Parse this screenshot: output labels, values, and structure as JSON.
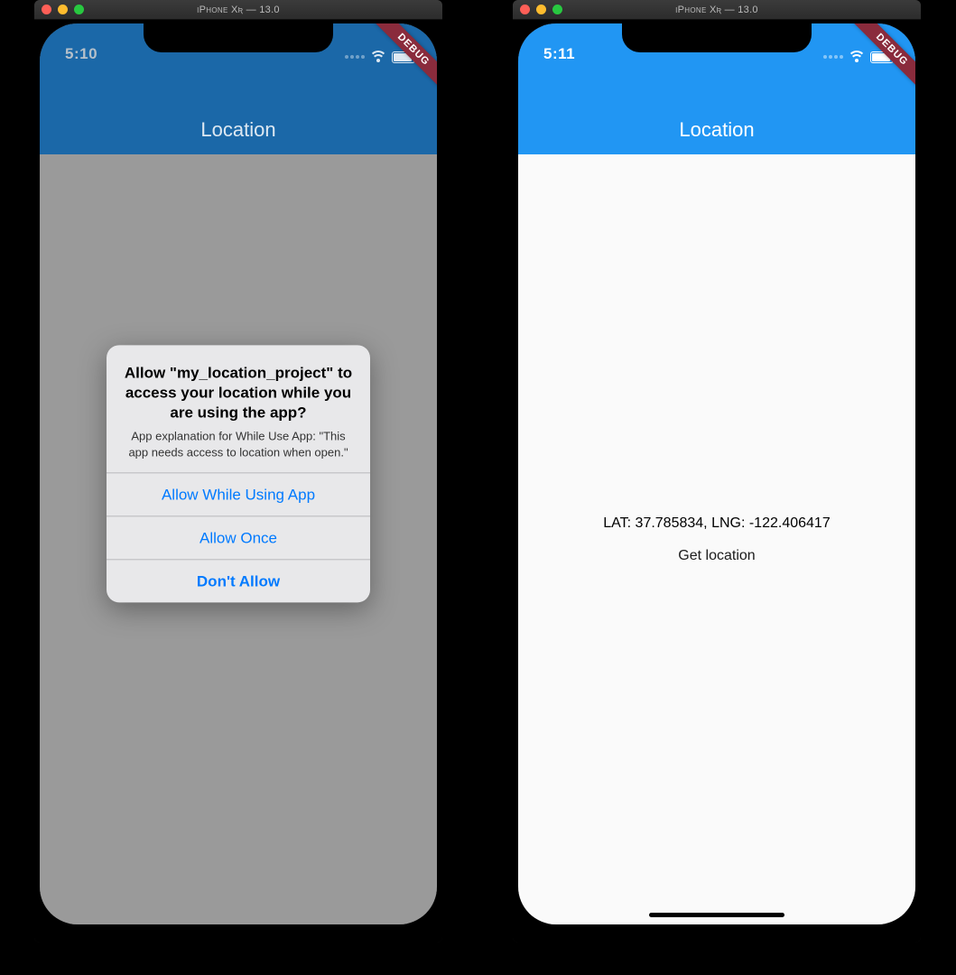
{
  "simulator": {
    "title": "iPhone Xʀ — 13.0",
    "debug_label": "DEBUG"
  },
  "left": {
    "status_time": "5:10",
    "appbar_title": "Location",
    "alert": {
      "title": "Allow \"my_location_project\" to access your location while you are using the app?",
      "message": "App explanation for While Use App: \"This app needs access to location when open.\"",
      "buttons": {
        "allow_while": "Allow While Using App",
        "allow_once": "Allow Once",
        "dont_allow": "Don't Allow"
      }
    }
  },
  "right": {
    "status_time": "5:11",
    "appbar_title": "Location",
    "coords_text": "LAT: 37.785834, LNG: -122.406417",
    "get_location_label": "Get location"
  }
}
